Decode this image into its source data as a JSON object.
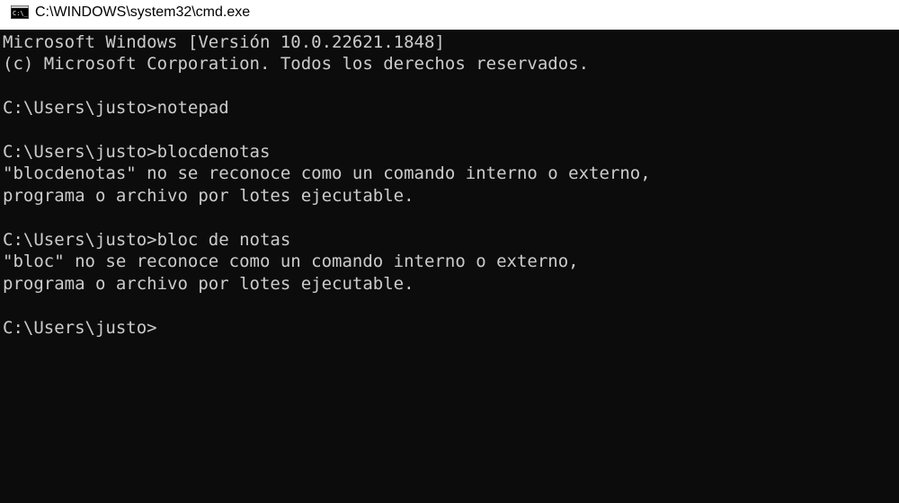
{
  "window": {
    "title": "C:\\WINDOWS\\system32\\cmd.exe",
    "icon": "cmd-icon"
  },
  "console": {
    "lines": [
      "Microsoft Windows [Versión 10.0.22621.1848]",
      "(c) Microsoft Corporation. Todos los derechos reservados.",
      "",
      "C:\\Users\\justo>notepad",
      "",
      "C:\\Users\\justo>blocdenotas",
      "\"blocdenotas\" no se reconoce como un comando interno o externo,",
      "programa o archivo por lotes ejecutable.",
      "",
      "C:\\Users\\justo>bloc de notas",
      "\"bloc\" no se reconoce como un comando interno o externo,",
      "programa o archivo por lotes ejecutable.",
      "",
      "C:\\Users\\justo>"
    ]
  },
  "colors": {
    "console_background": "#0c0c0c",
    "console_text": "#cccccc",
    "titlebar_background": "#ffffff"
  }
}
